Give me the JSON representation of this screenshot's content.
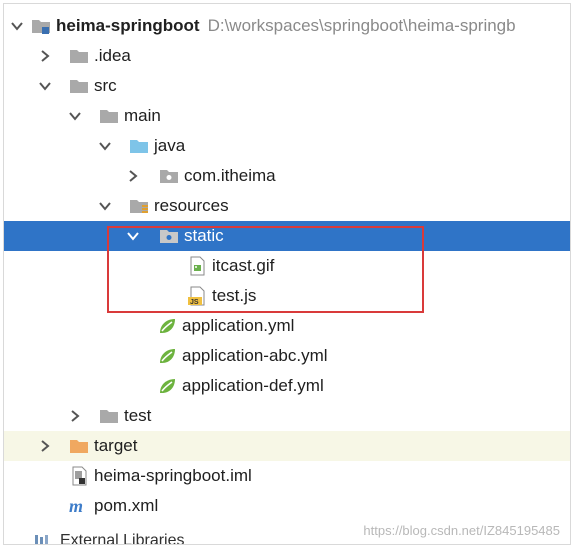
{
  "tree": {
    "root": {
      "label": "heima-springboot",
      "path": "D:\\workspaces\\springboot\\heima-springb"
    },
    "idea": {
      "label": ".idea"
    },
    "src": {
      "label": "src"
    },
    "main": {
      "label": "main"
    },
    "java": {
      "label": "java"
    },
    "package": {
      "label": "com.itheima"
    },
    "resources": {
      "label": "resources"
    },
    "static": {
      "label": "static"
    },
    "itcast_gif": {
      "label": "itcast.gif"
    },
    "test_js": {
      "label": "test.js"
    },
    "application_yml": {
      "label": "application.yml"
    },
    "application_abc_yml": {
      "label": "application-abc.yml"
    },
    "application_def_yml": {
      "label": "application-def.yml"
    },
    "test": {
      "label": "test"
    },
    "target": {
      "label": "target"
    },
    "iml": {
      "label": "heima-springboot.iml"
    },
    "pom": {
      "label": "pom.xml"
    },
    "external": {
      "label": "External Libraries"
    }
  },
  "watermark": "https://blog.csdn.net/IZ845195485",
  "colors": {
    "selection": "#2f74c7",
    "highlight_border": "#d93a3a",
    "folder": "#a9a9a9",
    "target_folder": "#f0a860",
    "source_folder": "#7ec4e8"
  }
}
